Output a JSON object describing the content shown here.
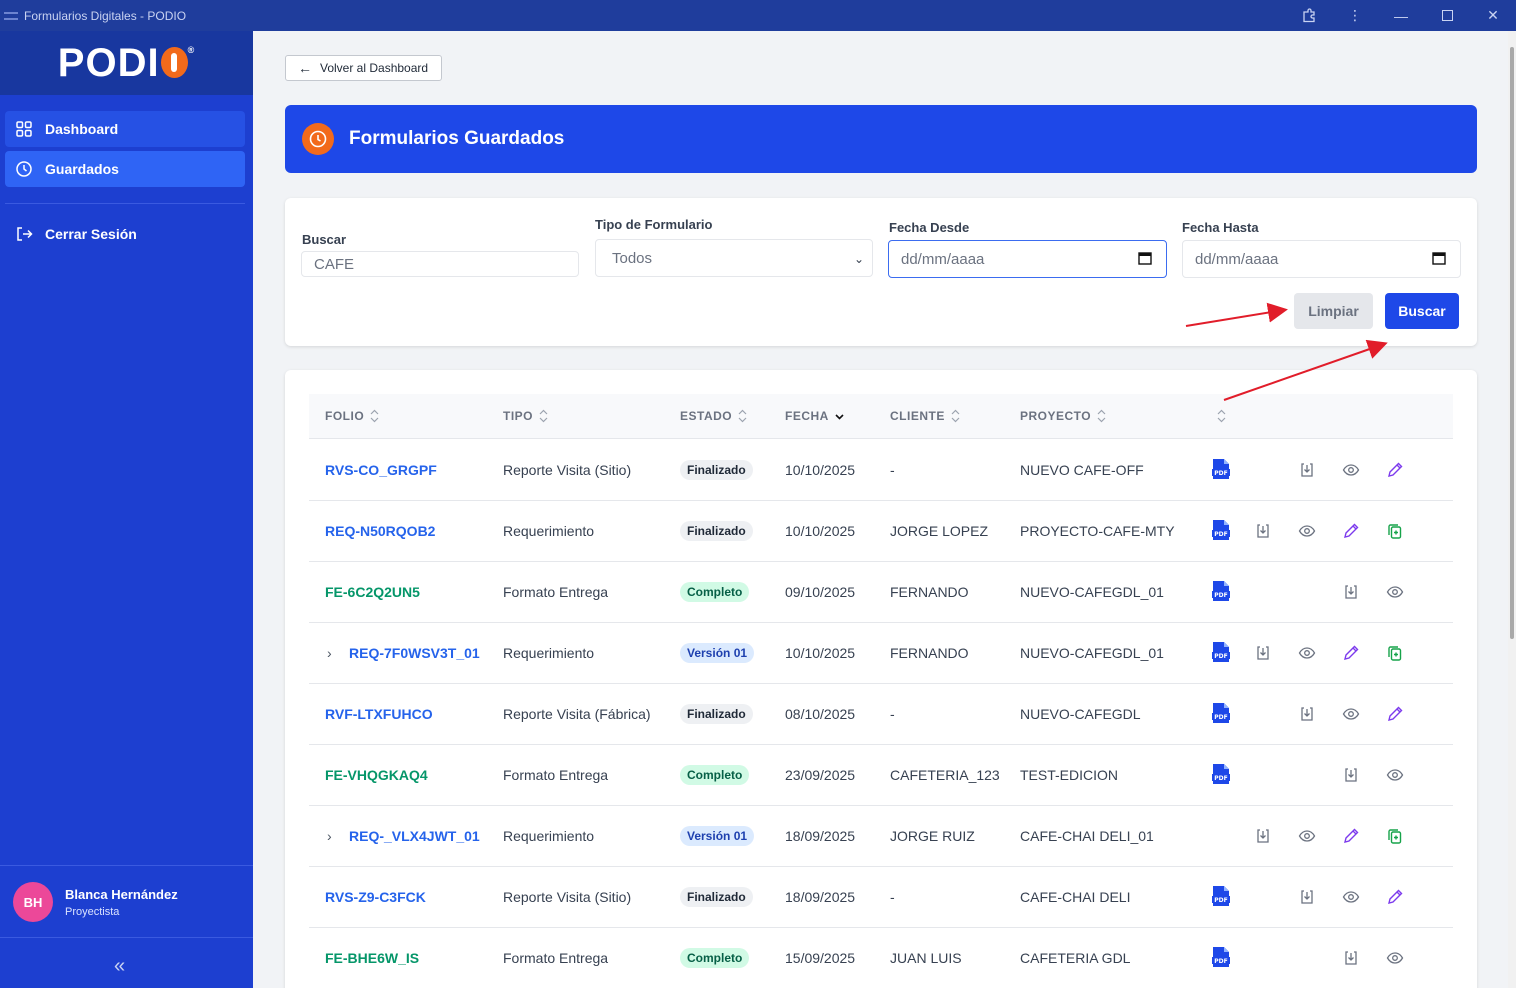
{
  "window": {
    "title": "Formularios Digitales - PODIO"
  },
  "sidebar": {
    "logo": "PODIO",
    "items": [
      {
        "label": "Dashboard",
        "icon": "grid-icon"
      },
      {
        "label": "Guardados",
        "icon": "clock-icon"
      }
    ],
    "logout_label": "Cerrar Sesión",
    "user": {
      "initials": "BH",
      "name": "Blanca Hernández",
      "role": "Proyectista"
    }
  },
  "main": {
    "back_label": "Volver al Dashboard",
    "banner_title": "Formularios Guardados",
    "filters": {
      "search_label": "Buscar",
      "search_value": "CAFE",
      "type_label": "Tipo de Formulario",
      "type_value": "Todos",
      "from_label": "Fecha Desde",
      "from_placeholder": "dd/mm/aaaa",
      "to_label": "Fecha Hasta",
      "to_placeholder": "dd/mm/aaaa",
      "clear_label": "Limpiar",
      "search_button": "Buscar"
    },
    "table": {
      "headers": [
        "FOLIO",
        "TIPO",
        "ESTADO",
        "FECHA",
        "CLIENTE",
        "PROYECTO"
      ],
      "rows": [
        {
          "folio": "RVS-CO_GRGPF",
          "tipo": "Reporte Visita (Sitio)",
          "estado": "Finalizado",
          "fecha": "10/10/2025",
          "cliente": "-",
          "proyecto": "NUEVO CAFE-OFF"
        },
        {
          "folio": "REQ-N50RQOB2",
          "tipo": "Requerimiento",
          "estado": "Finalizado",
          "fecha": "10/10/2025",
          "cliente": "JORGE LOPEZ",
          "proyecto": "PROYECTO-CAFE-MTY"
        },
        {
          "folio": "FE-6C2Q2UN5",
          "tipo": "Formato Entrega",
          "estado": "Completo",
          "fecha": "09/10/2025",
          "cliente": "FERNANDO",
          "proyecto": "NUEVO-CAFEGDL_01"
        },
        {
          "folio": "REQ-7F0WSV3T_01",
          "tipo": "Requerimiento",
          "estado": "Versión 01",
          "fecha": "10/10/2025",
          "cliente": "FERNANDO",
          "proyecto": "NUEVO-CAFEGDL_01"
        },
        {
          "folio": "RVF-LTXFUHCO",
          "tipo": "Reporte Visita (Fábrica)",
          "estado": "Finalizado",
          "fecha": "08/10/2025",
          "cliente": "-",
          "proyecto": "NUEVO-CAFEGDL"
        },
        {
          "folio": "FE-VHQGKAQ4",
          "tipo": "Formato Entrega",
          "estado": "Completo",
          "fecha": "23/09/2025",
          "cliente": "CAFETERIA_123",
          "proyecto": "TEST-EDICION"
        },
        {
          "folio": "REQ-_VLX4JWT_01",
          "tipo": "Requerimiento",
          "estado": "Versión 01",
          "fecha": "18/09/2025",
          "cliente": "JORGE RUIZ",
          "proyecto": "CAFE-CHAI DELI_01"
        },
        {
          "folio": "RVS-Z9-C3FCK",
          "tipo": "Reporte Visita (Sitio)",
          "estado": "Finalizado",
          "fecha": "18/09/2025",
          "cliente": "-",
          "proyecto": "CAFE-CHAI DELI"
        },
        {
          "folio": "FE-BHE6W_IS",
          "tipo": "Formato Entrega",
          "estado": "Completo",
          "fecha": "15/09/2025",
          "cliente": "JUAN LUIS",
          "proyecto": "CAFETERIA GDL"
        }
      ]
    }
  },
  "colors": {
    "sidebar": "#1d3fd0",
    "accent": "#1e48e8",
    "orange": "#f26a1b",
    "annotation": "#e11d2a"
  }
}
